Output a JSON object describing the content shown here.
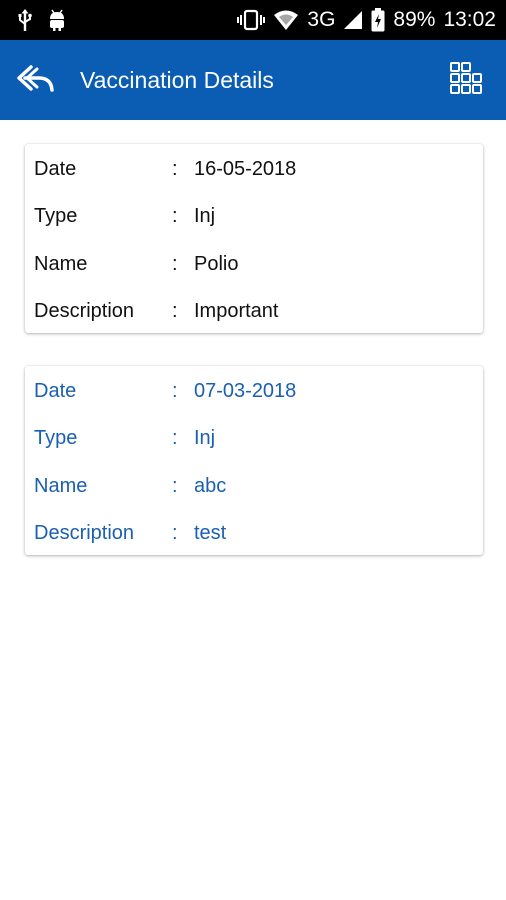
{
  "status_bar": {
    "battery": "89%",
    "network": "3G",
    "time": "13:02"
  },
  "app_bar": {
    "title": "Vaccination Details",
    "back_icon": "reply-arrow-icon",
    "menu_icon": "grid-icon"
  },
  "colors": {
    "app_bar": "#0b5cb3",
    "blue_text": "#1a5fb0"
  },
  "records": [
    {
      "date_label": "Date",
      "date": "16-05-2018",
      "type_label": "Type",
      "type": "Inj",
      "name_label": "Name",
      "name": "Polio",
      "description_label": "Description",
      "description": "Important"
    },
    {
      "date_label": "Date",
      "date": "07-03-2018",
      "type_label": "Type",
      "type": "Inj",
      "name_label": "Name",
      "name": "abc",
      "description_label": "Description",
      "description": "test"
    }
  ],
  "separator": ":"
}
